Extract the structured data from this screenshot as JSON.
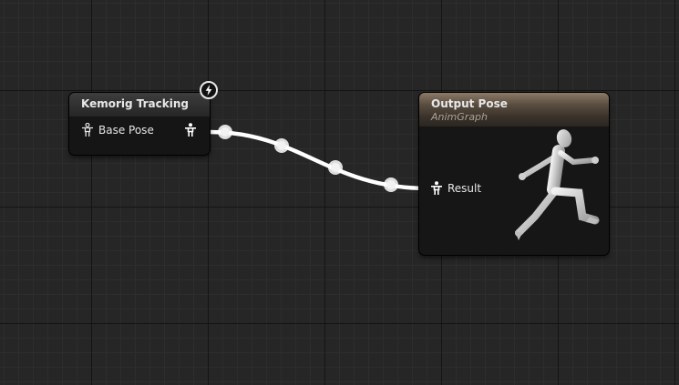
{
  "nodes": {
    "tracking": {
      "title": "Kemorig Tracking",
      "pin_label": "Base Pose",
      "badge_icon": "lightning-icon"
    },
    "output": {
      "title": "Output Pose",
      "subtitle": "AnimGraph",
      "pin_label": "Result",
      "preview_icon": "running-mannequin-icon"
    }
  },
  "colors": {
    "grid_background": "#262626",
    "wire": "#ffffff",
    "output_header": "#8c7a68"
  }
}
